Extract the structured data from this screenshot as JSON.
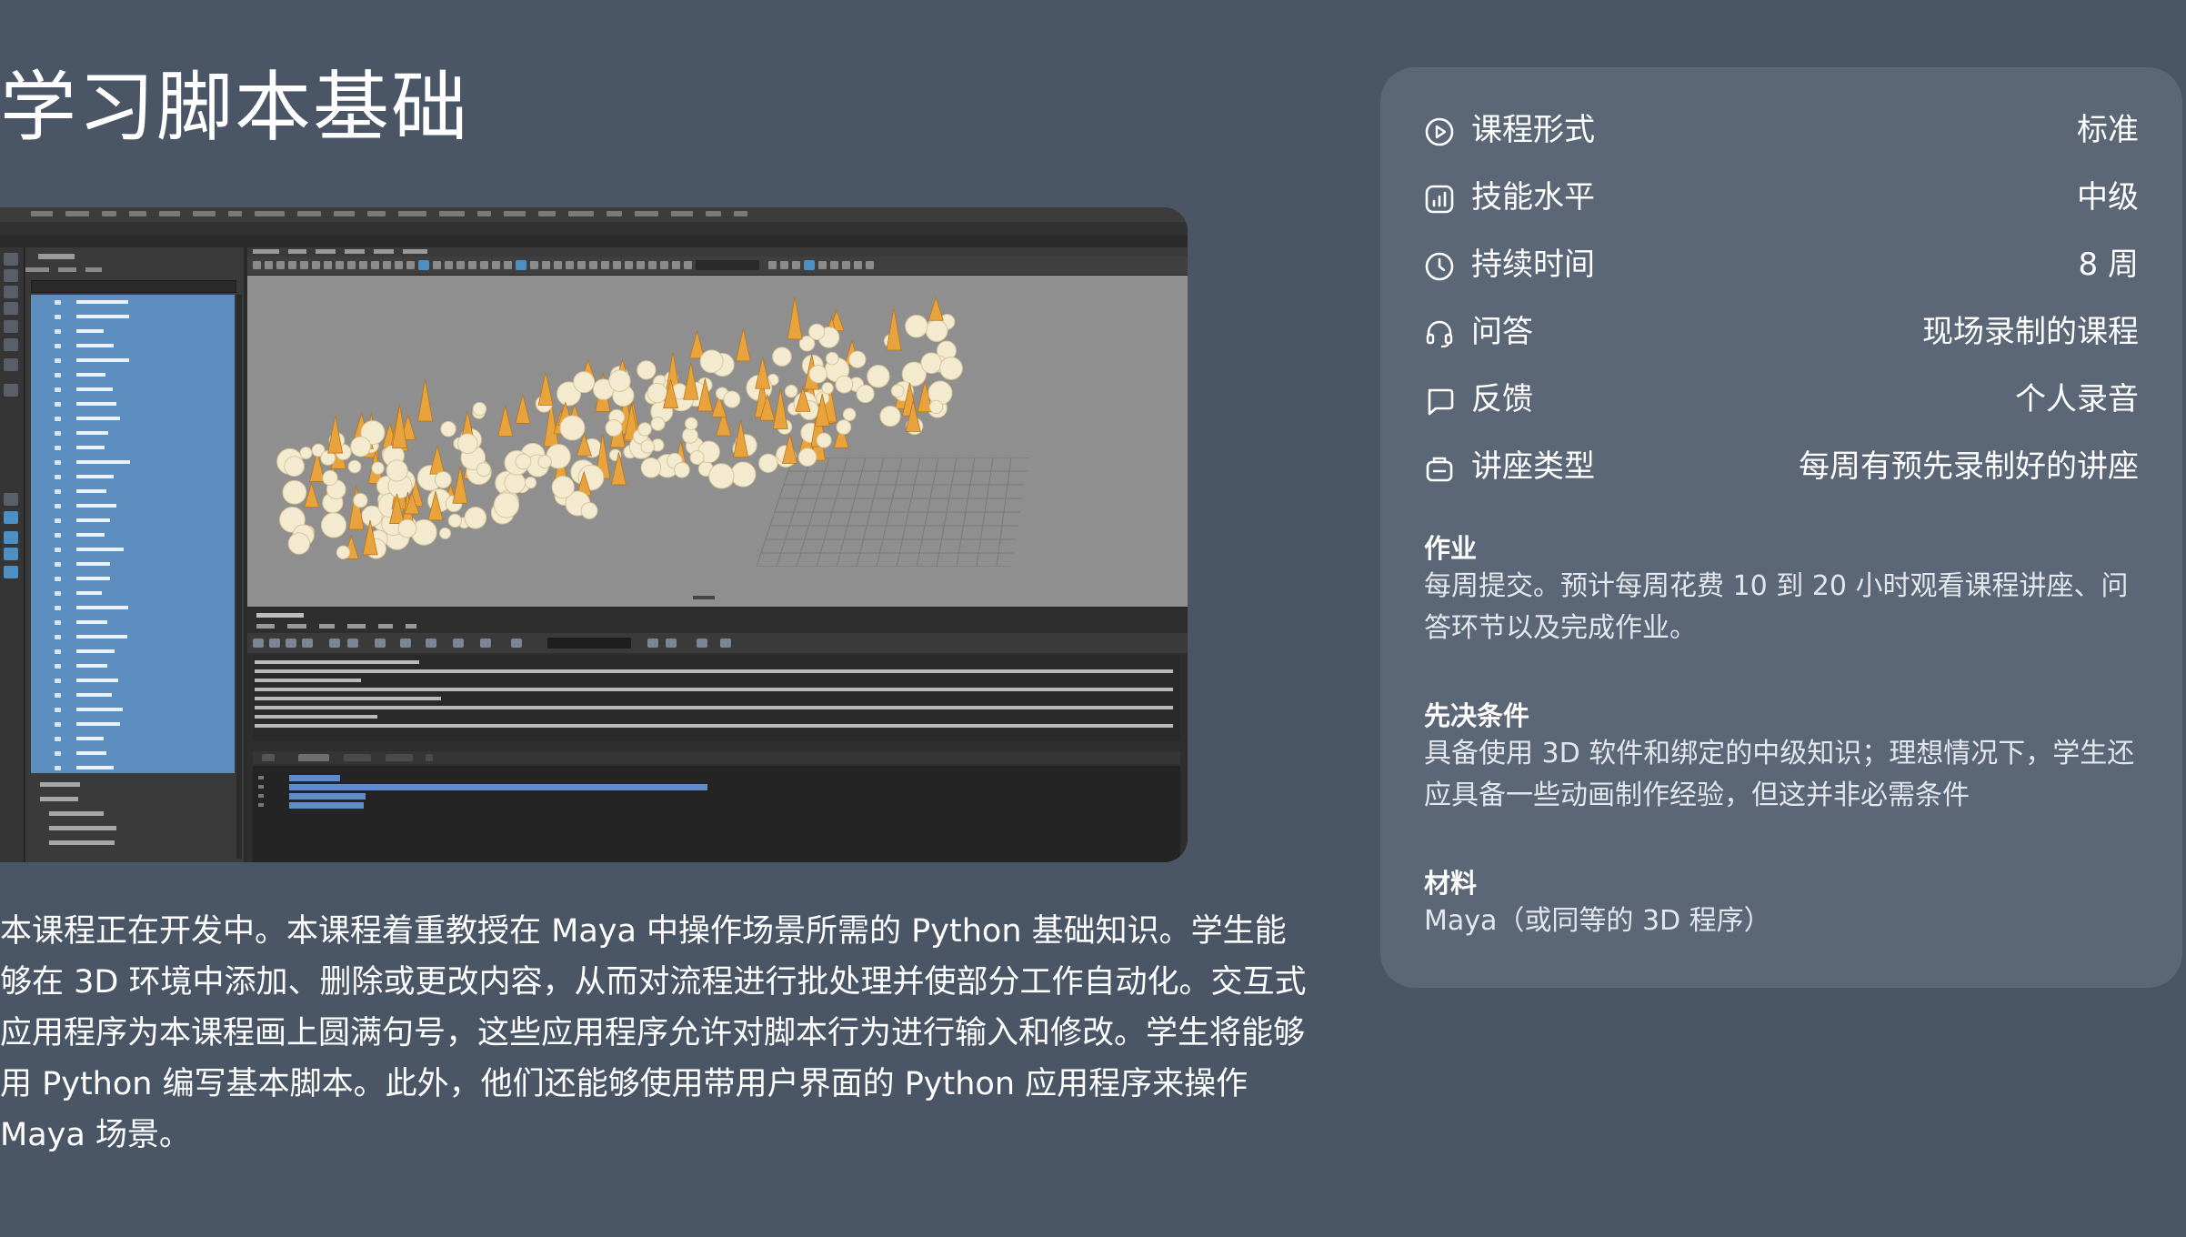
{
  "page": {
    "title": "学习脚本基础",
    "description": "本课程正在开发中。本课程着重教授在 Maya 中操作场景所需的 Python 基础知识。学生能够在 3D 环境中添加、删除或更改内容，从而对流程进行批处理并使部分工作自动化。交互式应用程序为本课程画上圆满句号，这些应用程序允许对脚本行为进行输入和修改。学生将能够用 Python 编写基本脚本。此外，他们还能够使用带用户界面的 Python 应用程序来操作 Maya 场景。"
  },
  "screenshot": {
    "image_description": "Maya 界面截图：大纲视图、透视视口中的树木场景、脚本编辑器",
    "colors": {
      "outliner_selection": "#5c8ec0",
      "viewport_bg": "#8f8f8f",
      "tree_white": "#f3ead0",
      "tree_orange": "#e8a33c"
    }
  },
  "course_info": {
    "rows": [
      {
        "icon": "play-circle-icon",
        "label": "课程形式",
        "value": "标准"
      },
      {
        "icon": "bar-chart-icon",
        "label": "技能水平",
        "value": "中级"
      },
      {
        "icon": "clock-icon",
        "label": "持续时间",
        "value": "8 周"
      },
      {
        "icon": "headset-icon",
        "label": "问答",
        "value": "现场录制的课程"
      },
      {
        "icon": "chat-bubble-icon",
        "label": "反馈",
        "value": "个人录音"
      },
      {
        "icon": "lecture-icon",
        "label": "讲座类型",
        "value": "每周有预先录制好的讲座"
      }
    ],
    "sections": [
      {
        "heading": "作业",
        "body": "每周提交。预计每周花费 10 到 20 小时观看课程讲座、问答环节以及完成作业。"
      },
      {
        "heading": "先决条件",
        "body": "具备使用 3D 软件和绑定的中级知识；理想情况下，学生还应具备一些动画制作经验，但这并非必需条件"
      },
      {
        "heading": "材料",
        "body": "Maya（或同等的 3D 程序）"
      }
    ]
  },
  "colors": {
    "page_bg": "#4a5566",
    "card_bg": "#5b6677",
    "text": "#ffffff"
  }
}
